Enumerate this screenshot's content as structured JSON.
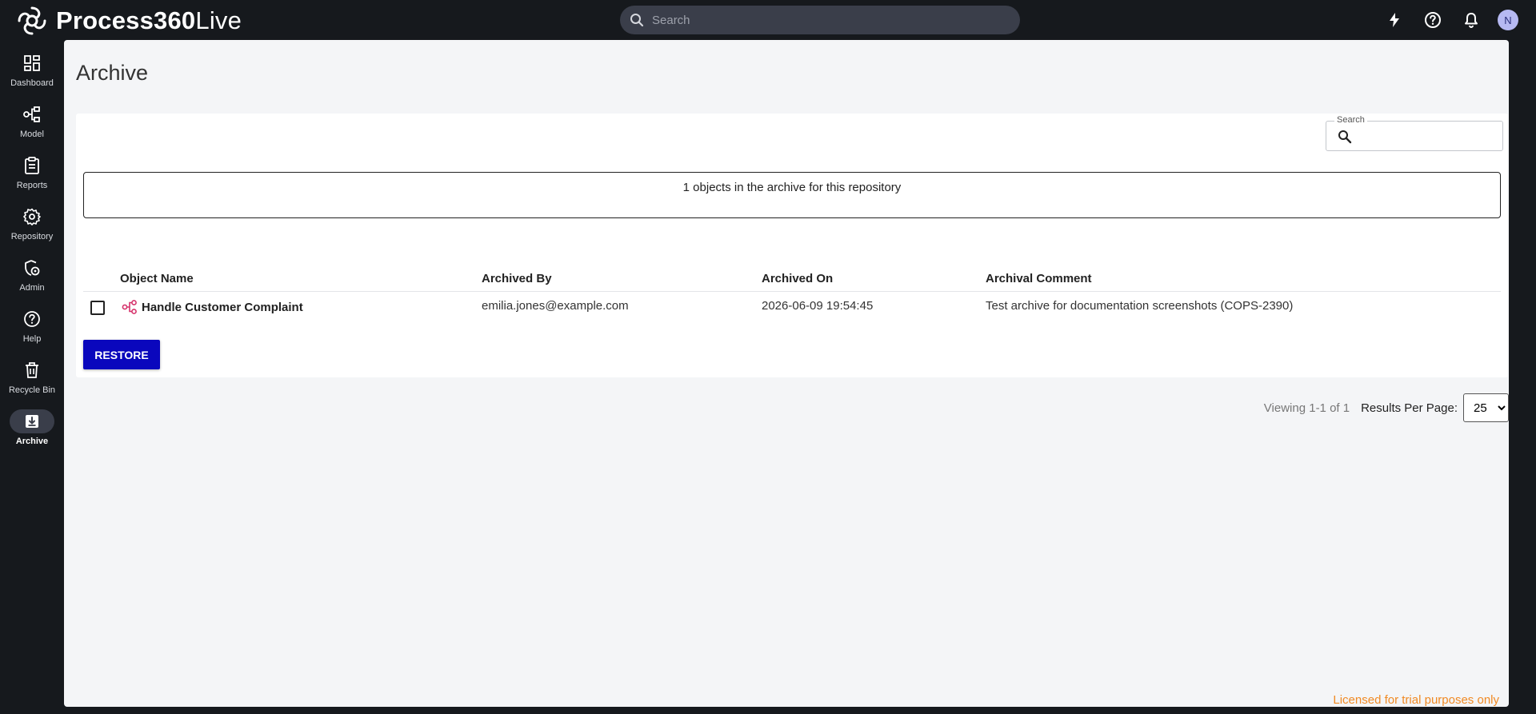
{
  "app": {
    "logo_bold": "Process360",
    "logo_light": "Live"
  },
  "topbar": {
    "search_placeholder": "Search",
    "avatar_initial": "N",
    "icons": [
      "lightning-icon",
      "help-circle-icon",
      "bell-icon"
    ]
  },
  "sidebar": {
    "items": [
      {
        "label": "Dashboard",
        "icon": "dashboard-icon"
      },
      {
        "label": "Model",
        "icon": "model-icon"
      },
      {
        "label": "Reports",
        "icon": "reports-icon"
      },
      {
        "label": "Repository",
        "icon": "gear-icon"
      },
      {
        "label": "Admin",
        "icon": "admin-icon"
      },
      {
        "label": "Help",
        "icon": "help-icon"
      },
      {
        "label": "Recycle Bin",
        "icon": "trash-icon"
      },
      {
        "label": "Archive",
        "icon": "archive-icon"
      }
    ],
    "active": "Archive"
  },
  "page": {
    "title": "Archive",
    "search_label": "Search",
    "search_value": "",
    "info_text": "1 objects in the archive for this repository",
    "columns": [
      "Object Name",
      "Archived By",
      "Archived On",
      "Archival Comment"
    ],
    "rows": [
      {
        "name": "Handle Customer Complaint",
        "archived_by": "emilia.jones@example.com",
        "archived_on": "2026-06-09 19:54:45",
        "comment": "Test archive for documentation screenshots (COPS-2390)"
      }
    ],
    "restore_label": "RESTORE",
    "viewing": "Viewing 1-1 of 1",
    "results_per_page_label": "Results Per Page:",
    "results_per_page_value": "25",
    "license_note": "Licensed for trial purposes only"
  },
  "colors": {
    "accent": "#0a07bd",
    "sidebar_bg": "#16191d",
    "license": "#f08a24",
    "object_icon": "#d6336c"
  }
}
